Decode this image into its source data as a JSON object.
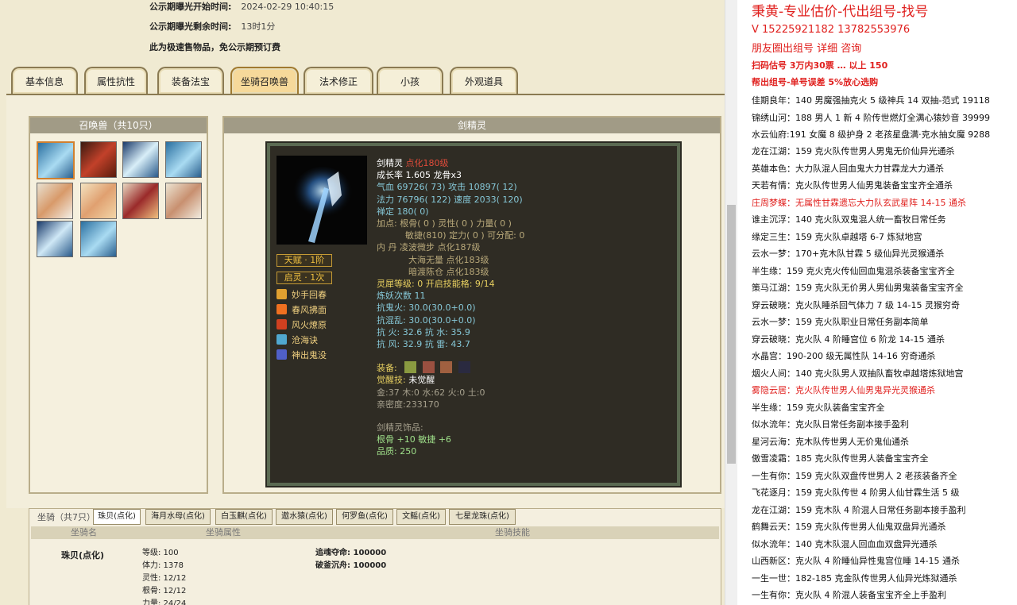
{
  "info": {
    "expose_start_label": "公示期曝光开始时间:",
    "expose_start_value": "2024-02-29 10:40:15",
    "expose_left_label": "公示期曝光剩余时间:",
    "expose_left_value": "13时1分",
    "quick_sale_note": "此为极速售物品，免公示期预订费"
  },
  "tabs": [
    "基本信息",
    "属性抗性",
    "装备法宝",
    "坐骑召唤兽",
    "法术修正",
    "小孩",
    "外观道具"
  ],
  "active_tab_index": 3,
  "summon": {
    "title": "召唤兽（共10只）",
    "pets": [
      "pet-1",
      "pet-2",
      "pet-3",
      "pet-4",
      "pet-5",
      "pet-6",
      "pet-7",
      "pet-8",
      "pet-9",
      "pet-10"
    ]
  },
  "detail": {
    "title": "剑精灵",
    "name": "剑精灵",
    "level_tag": "点化180级",
    "growth": "成长率 1.605 龙骨x3",
    "hp": "气血 69726( 73)",
    "attack": "攻击 10897( 12)",
    "mp": "法力 76796( 122)",
    "speed": "速度 2033( 120)",
    "chan": "禅定 180( 0)",
    "jiadian_1": "加点:  根骨( 0 ) 灵性( 0 ) 力量( 0 )",
    "jiadian_2": "敏捷(810) 定力( 0 ) 可分配:   0",
    "neidan_label": "内   丹",
    "neidan_1": "凌波微步 点化187级",
    "neidan_2": "大海无量 点化183级",
    "neidan_3": "暗渡陈仓 点化183级",
    "lingxi": "灵犀等级:  0  开启技能格:  9/14",
    "lianyao": "炼妖次数 11",
    "kang_1": "抗鬼火: 30.0(30.0+0.0)",
    "kang_2": "抗混乱: 30.0(30.0+0.0)",
    "kang_3": "抗   火: 32.6 抗   水: 35.9",
    "kang_4": "抗   风: 32.9 抗   雷: 43.7",
    "equip_label": "装备:",
    "juexing_label": "觉醒技:",
    "juexing_value": "未觉醒",
    "wuxing": "金:37 木:0 水:62 火:0 土:0",
    "qinmi": "亲密度:233170",
    "shipin_label": "剑精灵饰品:",
    "shipin_attr": "根骨 +10 敏捷 +6",
    "shipin_quality": "品质:  250",
    "tianfu": "天赋 · 1阶",
    "qiling": "启灵 · 1次",
    "skills": [
      "妙手回春",
      "春风拂面",
      "风火燎原",
      "沧海诀",
      "神出鬼没"
    ]
  },
  "bottom": {
    "title": "坐骑（共7只）",
    "tabs": [
      "珠贝(点化)",
      "海月水母(点化)",
      "白玉麒(点化)",
      "遨水猿(点化)",
      "何罗鱼(点化)",
      "文鳐(点化)",
      "七星龙珠(点化)"
    ],
    "col_1": "坐骑名",
    "col_2": "坐骑属性",
    "col_3": "坐骑技能",
    "mount_name": "珠贝(点化)",
    "attrs": [
      "等级: 100",
      "体力: 1378",
      "灵性: 12/12",
      "根骨: 12/12",
      "力量: 24/24"
    ],
    "skills": [
      "追魂夺命: 100000",
      "破釜沉舟: 100000"
    ]
  },
  "ad": {
    "lines": [
      {
        "text": "秉黄-专业估价-代出组号-找号",
        "style": "red big"
      },
      {
        "text": "V 15225921182   13782553976",
        "style": "red mid"
      },
      {
        "text": "朋友圈出组号   详细   咨询",
        "style": "red mid"
      },
      {
        "text": "扫码估号 3万内30票 … 以上 150",
        "style": "red bold"
      },
      {
        "text": "帮出组号-单号误差 5%放心选购",
        "style": "red bold"
      },
      {
        "text": "佳期良年：140 男魔强抽克火 5 级神兵 14 双抽-范式 19118",
        "style": ""
      },
      {
        "text": "锦绣山河：188 男人 1 新 4 阶传世燃灯全满心猿妙音 39999",
        "style": ""
      },
      {
        "text": "水云仙府:191 女魔 8 级护身 2 老孩星盘满·克水抽女魔 9288",
        "style": ""
      },
      {
        "text": "龙在江湖：159 克火队传世男人男鬼无价仙异光通杀",
        "style": ""
      },
      {
        "text": "英雄本色：大力队混人回血鬼大力甘霖龙大力通杀",
        "style": ""
      },
      {
        "text": "天若有情：克火队传世男人仙男鬼装备宝宝齐全通杀",
        "style": ""
      },
      {
        "text": "庄周梦蝶：无属性甘霖遗忘大力队玄武星阵 14-15 通杀",
        "style": "red"
      },
      {
        "text": "谁主沉浮：140 克火队双鬼混人统一畜牧日常任务",
        "style": ""
      },
      {
        "text": "缘定三生：159 克火队卓越塔 6-7 炼狱地宫",
        "style": ""
      },
      {
        "text": "云水一梦：170+克木队甘霖 5 级仙异光灵猴通杀",
        "style": ""
      },
      {
        "text": "半生缘：159 克火克火传仙回血鬼混杀装备宝宝齐全",
        "style": ""
      },
      {
        "text": "策马江湖：159 克火队无价男人男仙男鬼装备宝宝齐全",
        "style": ""
      },
      {
        "text": "穿云破晓：克火队睡杀回气体力 7 级 14-15 灵猴穷奇",
        "style": ""
      },
      {
        "text": "云水一梦：159 克火队职业日常任务副本简单",
        "style": ""
      },
      {
        "text": "穿云破晓：克火队 4 阶睡宫位 6 阶龙 14-15 通杀",
        "style": ""
      },
      {
        "text": "水晶宫：190-200 级无属性队 14-16 穷奇通杀",
        "style": ""
      },
      {
        "text": "烟火人间：140 克火队男人双抽队畜牧卓越塔炼狱地宫",
        "style": ""
      },
      {
        "text": "雾隐云居：克火队传世男人仙男鬼异光灵猴通杀",
        "style": "red"
      },
      {
        "text": "半生缘：159 克火队装备宝宝齐全",
        "style": ""
      },
      {
        "text": "似水流年：克火队日常任务副本接手盈利",
        "style": ""
      },
      {
        "text": "星河云海：克木队传世男人无价鬼仙通杀",
        "style": ""
      },
      {
        "text": "傲雪凌霜：185 克火队传世男人装备宝宝齐全",
        "style": ""
      },
      {
        "text": "一生有你：159 克火队双盘传世男人 2 老孩装备齐全",
        "style": ""
      },
      {
        "text": "飞花逐月：159 克火队传世 4 阶男人仙甘霖生活 5 级",
        "style": ""
      },
      {
        "text": "龙在江湖：159 克木队 4 阶混人日常任务副本接手盈利",
        "style": ""
      },
      {
        "text": "鹤舞云天：159 克火队传世男人仙鬼双盘异光通杀",
        "style": ""
      },
      {
        "text": "似水流年：140 克木队混人回血血双盘异光通杀",
        "style": ""
      },
      {
        "text": "山西新区：克火队 4 阶睡仙异性鬼宫位睡 14-15 通杀",
        "style": ""
      },
      {
        "text": "一生一世：182-185 克金队传世男人仙异光炼狱通杀",
        "style": ""
      },
      {
        "text": "一生有你：克火队 4 阶混人装备宝宝齐全上手盈利",
        "style": ""
      }
    ]
  }
}
